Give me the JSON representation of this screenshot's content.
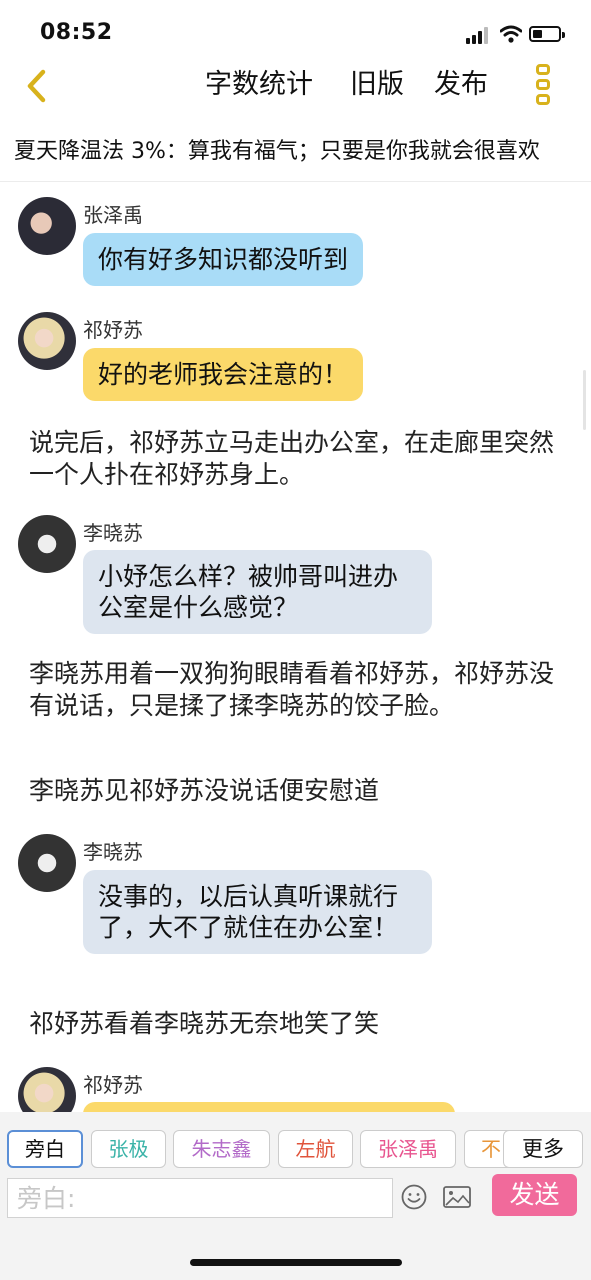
{
  "status": {
    "time": "08:52"
  },
  "nav": {
    "word_count": "字数统计",
    "old_version": "旧版",
    "publish": "发布"
  },
  "doc": {
    "title": "夏天降温法 3%：算我有福气；只要是你我就会很喜欢"
  },
  "messages": [
    {
      "sender": "张泽禹",
      "text": "你有好多知识都没听到",
      "color": "#a9dcf7"
    },
    {
      "sender": "祁妤苏",
      "text": "好的老师我会注意的！",
      "color": "#fbd96a"
    },
    {
      "narration": "说完后，祁妤苏立马走出办公室，在走廊里突然一个人扑在祁妤苏身上。"
    },
    {
      "sender": "李晓苏",
      "text": "小妤怎么样？被帅哥叫进办公室是什么感觉？",
      "color": "#dde5ef"
    },
    {
      "narration": "李晓苏用着一双狗狗眼睛看着祁妤苏，祁妤苏没有说话，只是揉了揉李晓苏的饺子脸。"
    },
    {
      "narration": "李晓苏见祁妤苏没说话便安慰道"
    },
    {
      "sender": "李晓苏",
      "text": "没事的，以后认真听课就行了，大不了就住在办公室！",
      "color": "#dde5ef"
    },
    {
      "narration": "祁妤苏看着李晓苏无奈地笑了笑"
    },
    {
      "sender": "祁妤苏",
      "text": "",
      "color": "#fbd96a"
    }
  ],
  "roles": [
    {
      "label": "旁白",
      "color": "#111111"
    },
    {
      "label": "张极",
      "color": "#3bb3a8"
    },
    {
      "label": "朱志鑫",
      "color": "#b26ac8"
    },
    {
      "label": "左航",
      "color": "#e0533a"
    },
    {
      "label": "张泽禹",
      "color": "#e8558f"
    },
    {
      "label": "不",
      "color": "#e8963a"
    }
  ],
  "more_label": "更多",
  "input": {
    "placeholder": "旁白:"
  },
  "send_label": "发送",
  "icons": {
    "back": "chevron-left-icon",
    "more": "vertical-dots-icon",
    "emoji": "smiley-icon",
    "image": "image-icon",
    "signal": "signal-icon",
    "wifi": "wifi-icon",
    "battery": "battery-icon"
  }
}
